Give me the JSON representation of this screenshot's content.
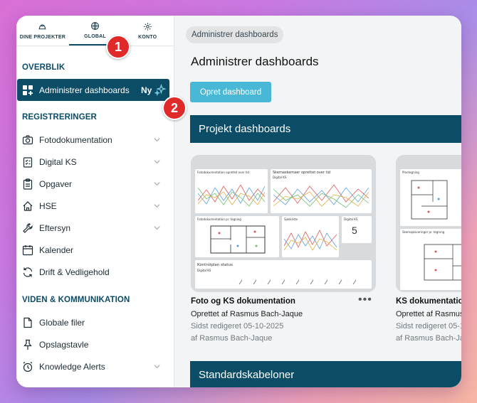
{
  "topnav": {
    "tabs": [
      {
        "label": "DINE PROJEKTER",
        "icon": "hardhat-icon"
      },
      {
        "label": "GLOBAL",
        "icon": "globe-icon",
        "active": true
      },
      {
        "label": "KONTO",
        "icon": "gear-icon"
      }
    ]
  },
  "sidebar": {
    "section_overview": "OVERBLIK",
    "active_item": {
      "label": "Administrer dashboards",
      "badge": "Ny"
    },
    "section_registrations": "REGISTRERINGER",
    "registrations": [
      {
        "label": "Fotodokumentation",
        "icon": "camera-icon",
        "chevron": true
      },
      {
        "label": "Digital KS",
        "icon": "checklist-icon",
        "chevron": true
      },
      {
        "label": "Opgaver",
        "icon": "clipboard-icon",
        "chevron": true
      },
      {
        "label": "HSE",
        "icon": "house-icon",
        "chevron": true
      },
      {
        "label": "Eftersyn",
        "icon": "wrench-icon",
        "chevron": true
      },
      {
        "label": "Kalender",
        "icon": "calendar-icon",
        "chevron": false
      },
      {
        "label": "Drift & Vedligehold",
        "icon": "refresh-icon",
        "chevron": false
      }
    ],
    "section_knowledge": "VIDEN & KOMMUNIKATION",
    "knowledge": [
      {
        "label": "Globale filer",
        "icon": "file-icon",
        "chevron": false
      },
      {
        "label": "Opslagstavle",
        "icon": "pin-icon",
        "chevron": false
      },
      {
        "label": "Knowledge Alerts",
        "icon": "alarm-icon",
        "chevron": true
      }
    ]
  },
  "markers": [
    "1",
    "2"
  ],
  "main": {
    "breadcrumb": "Administrer dashboards",
    "title": "Administrer dashboards",
    "create_button": "Opret dashboard",
    "project_section": "Projekt dashboards",
    "standard_section": "Standardskabeloner",
    "cards": [
      {
        "title": "Foto og KS dokumentation",
        "created_by": "Oprettet af Rasmus Bach-Jaque",
        "edited": "Sidst redigeret 05-10-2025",
        "edited_by": "af Rasmus Bach-Jaque",
        "thumb": {
          "w1": "Fotodokumentation oprettet over tid",
          "w2": "Skemaskemaer oprettet over tid",
          "w2_sub": "Digital KS",
          "w3": "Fotodokumentation pr. tegning",
          "w4": "Sjekkliste",
          "w5": "Digital KS",
          "w5_value": "5",
          "w6": "Kontrolplan status",
          "w6_sub": "Digital KS"
        }
      },
      {
        "title": "KS dokumentation",
        "created_by": "Oprettet af Rasmus Bach-Jaque",
        "edited": "Sidst redigeret 05-10-2025",
        "edited_by": "af Rasmus Bach-Jaque",
        "thumb": {
          "w1": "Plantegning",
          "w2": "Skemaplaceringer pr. tegning"
        }
      }
    ]
  },
  "colors": {
    "primary": "#0b4c66",
    "accent": "#49b8d6",
    "marker": "#e02a2a"
  }
}
